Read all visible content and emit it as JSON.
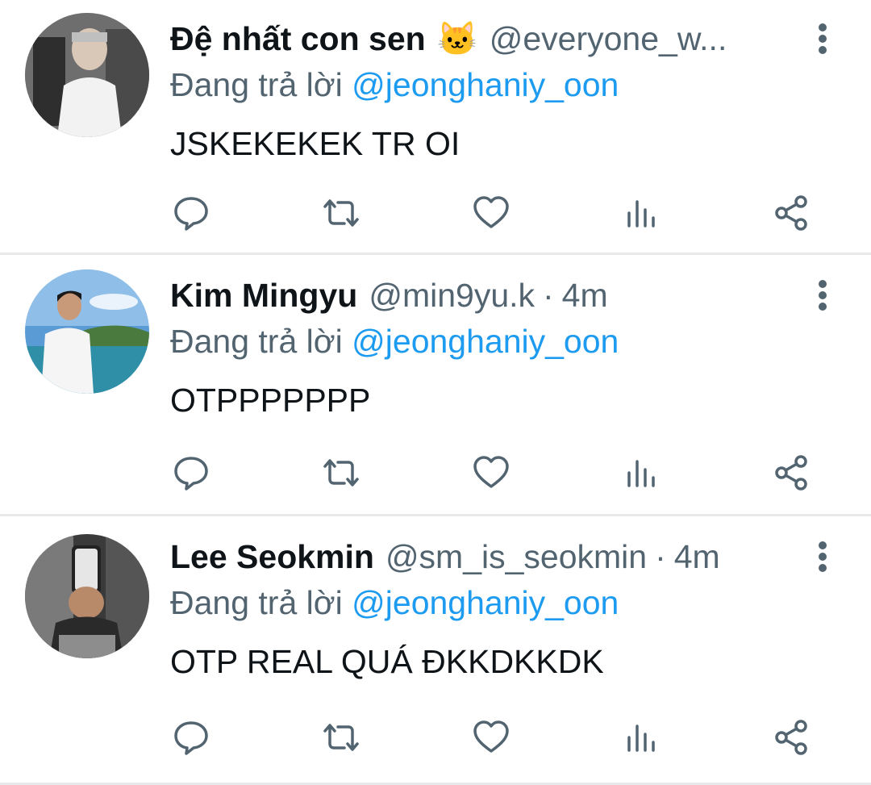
{
  "tweets": [
    {
      "name": "Đệ nhất con sen",
      "emoji": "🐱",
      "handle": "@everyone_w...",
      "time": "",
      "reply_prefix": "Đang trả lời",
      "reply_to": "@jeonghaniy_oon",
      "text": "JSKEKEKEK TR OI"
    },
    {
      "name": "Kim Mingyu",
      "emoji": "",
      "handle": "@min9yu.k",
      "time": "4m",
      "reply_prefix": "Đang trả lời",
      "reply_to": "@jeonghaniy_oon",
      "text": "OTPPPPPPP"
    },
    {
      "name": "Lee Seokmin",
      "emoji": "",
      "handle": "@sm_is_seokmin",
      "time": "4m",
      "reply_prefix": "Đang trả lời",
      "reply_to": "@jeonghaniy_oon",
      "text": "OTP REAL QUÁ ĐKKDKKDK"
    }
  ],
  "icons": {
    "more": "more-vertical-icon",
    "reply": "reply-icon",
    "retweet": "retweet-icon",
    "like": "heart-icon",
    "views": "analytics-icon",
    "share": "share-icon"
  },
  "colors": {
    "text": "#0f1419",
    "muted": "#536471",
    "mention": "#1d9bf0",
    "divider": "#e7e9ea"
  }
}
